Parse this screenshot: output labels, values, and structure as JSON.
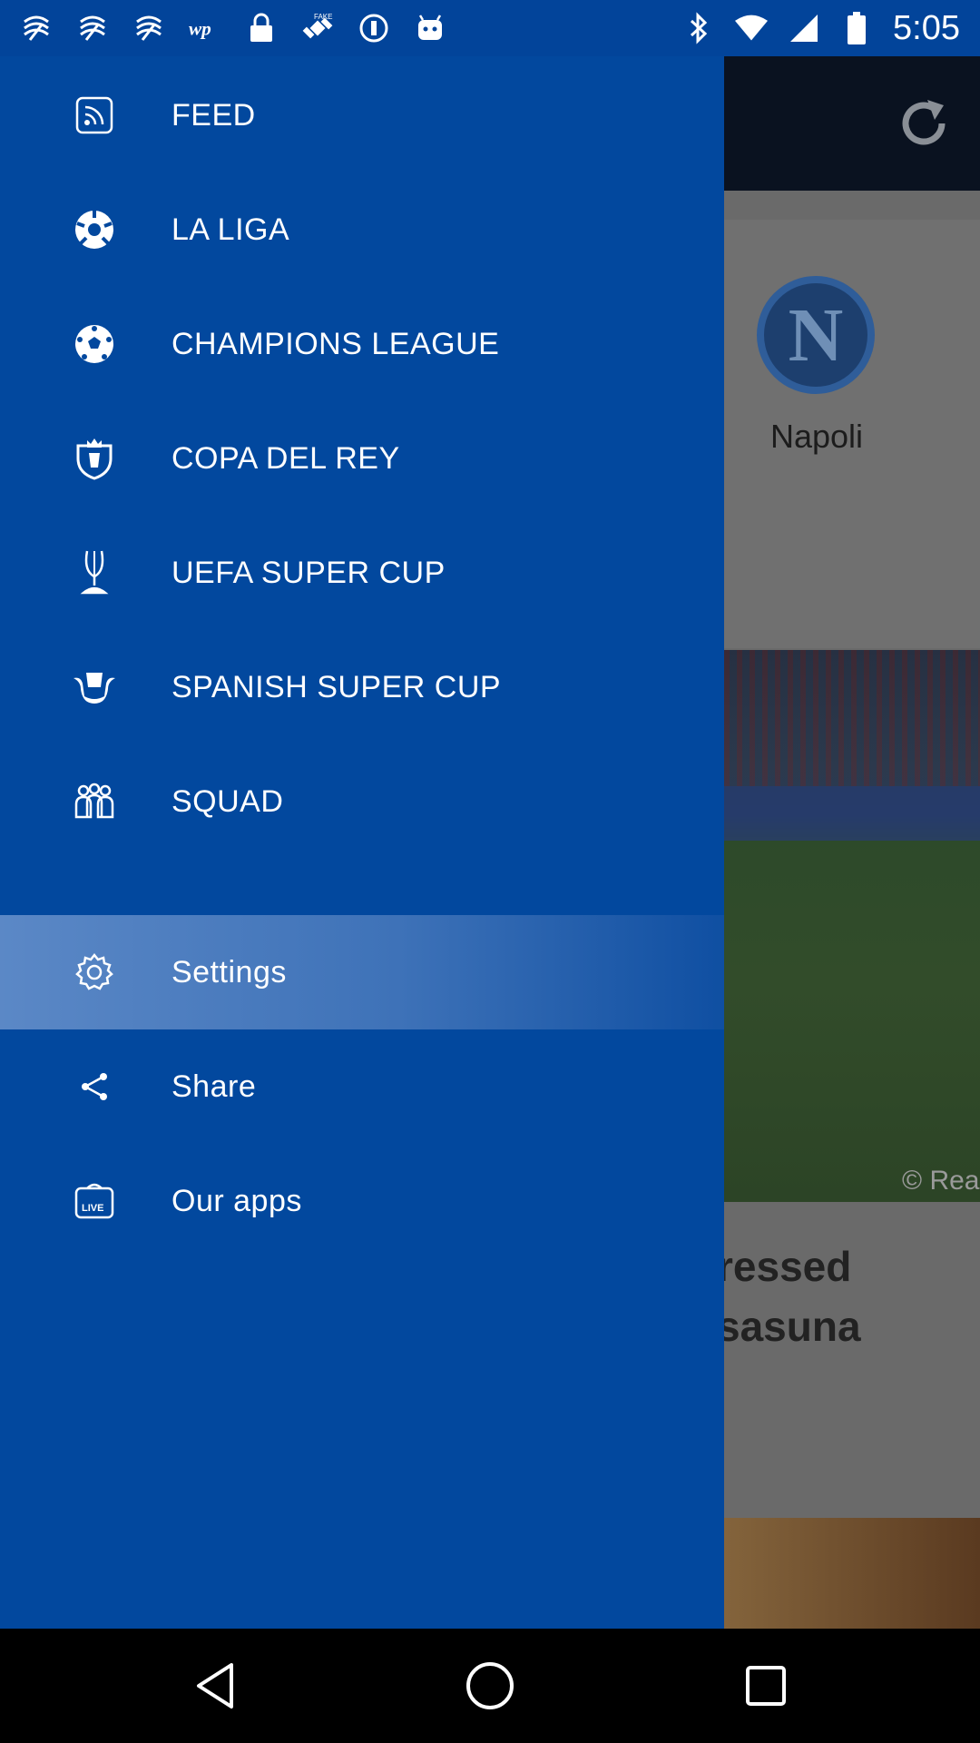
{
  "status_bar": {
    "time": "5:05",
    "left_icons": [
      "gym-app-icon",
      "gym-app-icon",
      "gym-app-icon",
      "washington-post-icon",
      "lock-icon",
      "fake-gps-icon",
      "info-icon",
      "android-icon"
    ],
    "right_icons": [
      "bluetooth-icon",
      "wifi-icon",
      "signal-icon",
      "battery-icon"
    ]
  },
  "background_app": {
    "team_logo_letter": "N",
    "team_name": "Napoli",
    "photo_credit": "© Rea",
    "headline_line1": "ressed",
    "headline_line2": "sasuna"
  },
  "drawer": {
    "items": [
      {
        "label": "FEED",
        "icon": "feed-icon"
      },
      {
        "label": "LA LIGA",
        "icon": "la-liga-icon"
      },
      {
        "label": "CHAMPIONS LEAGUE",
        "icon": "champions-league-icon"
      },
      {
        "label": "COPA DEL REY",
        "icon": "copa-del-rey-icon"
      },
      {
        "label": "UEFA SUPER CUP",
        "icon": "uefa-super-cup-icon"
      },
      {
        "label": "SPANISH SUPER CUP",
        "icon": "spanish-super-cup-icon"
      },
      {
        "label": "SQUAD",
        "icon": "squad-icon"
      },
      {
        "label": "Settings",
        "icon": "gear-icon",
        "selected": true
      },
      {
        "label": "Share",
        "icon": "share-icon"
      },
      {
        "label": "Our apps",
        "icon": "live-tv-icon"
      }
    ]
  },
  "colors": {
    "drawer_bg": "#02489e",
    "selected_bg": "#5b88c6",
    "status_bar_bg": "#02449a"
  }
}
